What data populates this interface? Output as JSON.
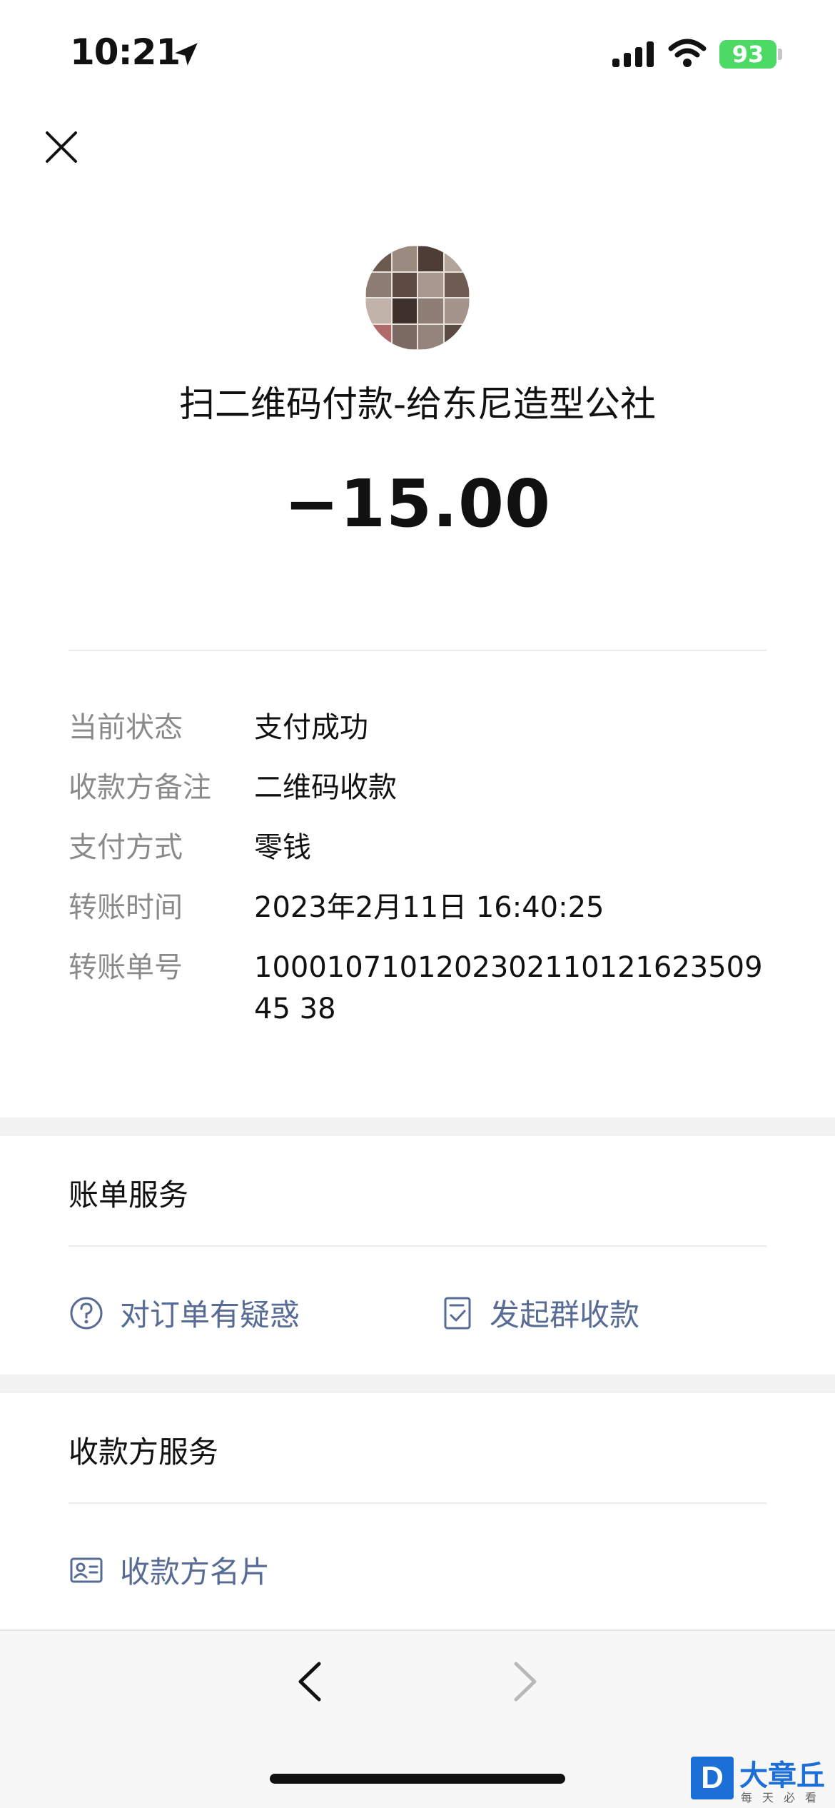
{
  "status_bar": {
    "time": "10:21",
    "battery": "93"
  },
  "header": {
    "close_icon": "close-icon"
  },
  "payee": {
    "title": "扫二维码付款-给东尼造型公社",
    "amount": "−15.00"
  },
  "details": [
    {
      "label": "当前状态",
      "value": "支付成功"
    },
    {
      "label": "收款方备注",
      "value": "二维码收款"
    },
    {
      "label": "支付方式",
      "value": "零钱"
    },
    {
      "label": "转账时间",
      "value": "2023年2月11日 16:40:25"
    },
    {
      "label": "转账单号",
      "value": "100010710120230211012162350945 38"
    }
  ],
  "bill_service": {
    "title": "账单服务",
    "actions": [
      {
        "label": "对订单有疑惑",
        "icon": "question-circle-icon"
      },
      {
        "label": "发起群收款",
        "icon": "receipt-check-icon"
      }
    ]
  },
  "payee_service": {
    "title": "收款方服务",
    "actions": [
      {
        "label": "收款方名片",
        "icon": "contact-card-icon"
      }
    ]
  },
  "watermark": {
    "letter": "D",
    "text": "大章丘",
    "sub": "每天必看"
  },
  "colors": {
    "link": "#576b95",
    "battery": "#4cd964",
    "divider": "#ececec"
  }
}
